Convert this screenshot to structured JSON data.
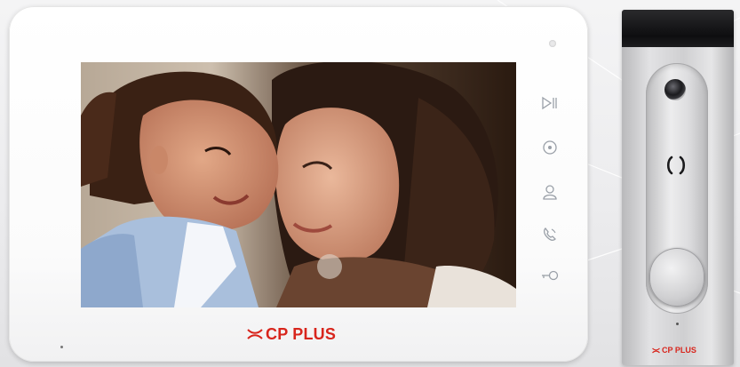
{
  "scene": {
    "background_color": "#ededef",
    "brand_color": "#d8251c"
  },
  "monitor": {
    "brand_text": "CP PLUS",
    "screen_content": "photo-mother-and-daughter",
    "controls": [
      {
        "name": "playback-icon"
      },
      {
        "name": "monitor-icon"
      },
      {
        "name": "intercom-icon"
      },
      {
        "name": "call-icon"
      },
      {
        "name": "unlock-key-icon"
      }
    ]
  },
  "doorcam": {
    "brand_text": "CP PLUS"
  }
}
